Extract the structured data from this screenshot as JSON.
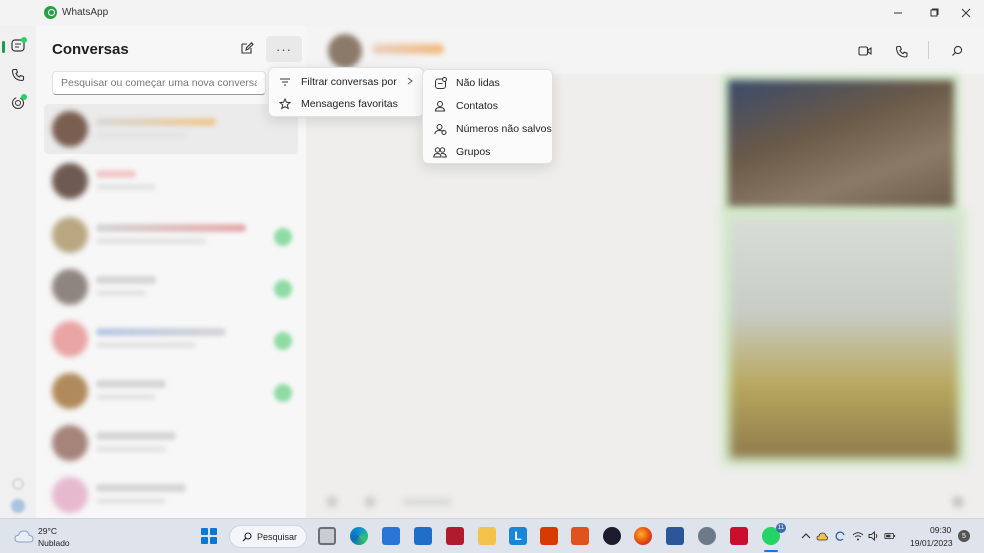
{
  "window": {
    "title": "WhatsApp"
  },
  "chatlist": {
    "title": "Conversas",
    "search_placeholder": "Pesquisar ou começar uma nova conversa",
    "menu_button_label": "···"
  },
  "options_menu": {
    "items": [
      {
        "label": "Filtrar conversas por",
        "icon": "filter-icon"
      },
      {
        "label": "Mensagens favoritas",
        "icon": "star-icon"
      }
    ]
  },
  "filter_submenu": {
    "items": [
      {
        "label": "Não lidas",
        "icon": "unread-icon"
      },
      {
        "label": "Contatos",
        "icon": "contact-icon"
      },
      {
        "label": "Números não salvos",
        "icon": "unsaved-number-icon"
      },
      {
        "label": "Grupos",
        "icon": "group-icon"
      }
    ]
  },
  "taskbar": {
    "weather_temp": "29°C",
    "weather_desc": "Nublado",
    "search_label": "Pesquisar",
    "whatsapp_badge": "11",
    "time": "09:30",
    "date": "19/01/2023",
    "notification_count": "5"
  },
  "colors": {
    "accent": "#1a9b52",
    "whatsapp_green": "#25d366",
    "windows_blue": "#0a78d4"
  }
}
